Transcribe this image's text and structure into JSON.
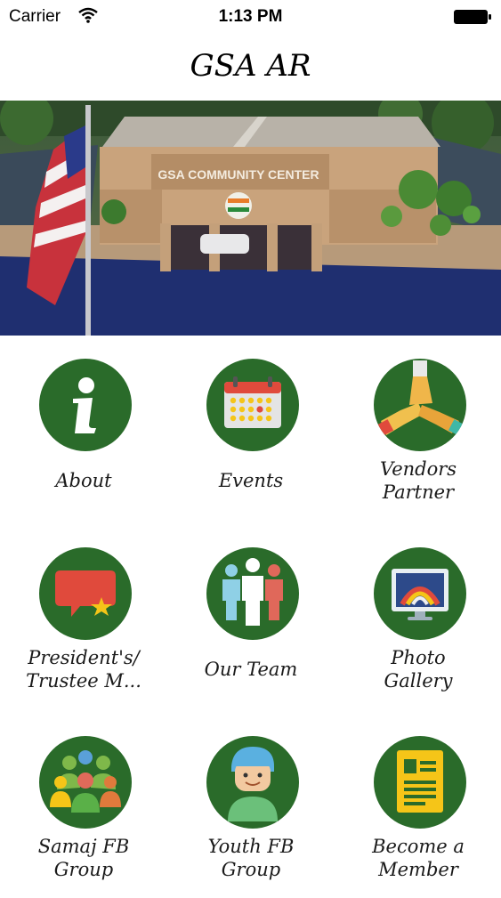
{
  "status_bar": {
    "carrier": "Carrier",
    "time": "1:13 PM"
  },
  "nav": {
    "title": "GSA AR"
  },
  "hero": {
    "sign_text": "GSA COMMUNITY CENTER"
  },
  "menu": [
    {
      "label": "About",
      "icon": "info-icon"
    },
    {
      "label": "Events",
      "icon": "calendar-icon"
    },
    {
      "label": "Vendors\nPartner",
      "icon": "handshake-icon"
    },
    {
      "label": "President's/\nTrustee M...",
      "icon": "message-star-icon"
    },
    {
      "label": "Our Team",
      "icon": "team-icon"
    },
    {
      "label": "Photo\nGallery",
      "icon": "photo-gallery-icon"
    },
    {
      "label": "Samaj FB\nGroup",
      "icon": "group-icon"
    },
    {
      "label": "Youth FB\nGroup",
      "icon": "youth-icon"
    },
    {
      "label": "Become a\nMember",
      "icon": "member-form-icon"
    }
  ],
  "colors": {
    "icon_circle": "#2a6b2a",
    "accent_red": "#e04a3c",
    "accent_yellow": "#f5c518"
  }
}
